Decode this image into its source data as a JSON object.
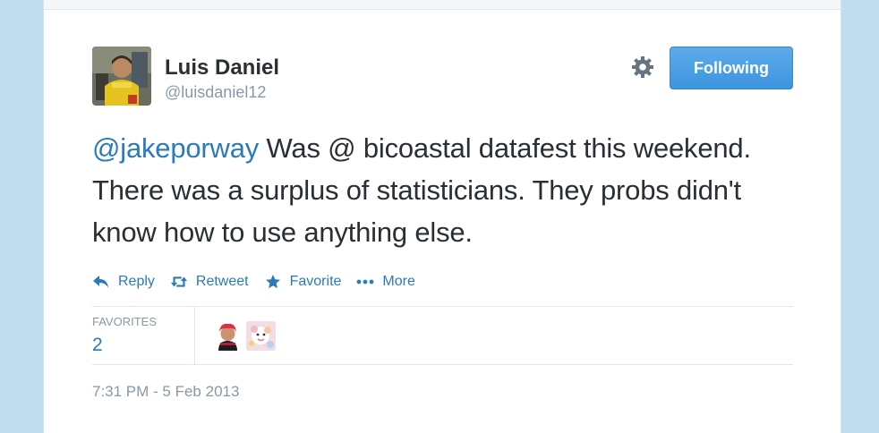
{
  "tweet": {
    "author_name": "Luis Daniel",
    "author_handle": "@luisdaniel12",
    "follow_label": "Following",
    "mention": "@jakeporway",
    "text": " Was @ bicoastal datafest this weekend. There was a surplus of statisticians. They probs didn't know how to use anything else.",
    "timestamp": "7:31 PM - 5 Feb 2013"
  },
  "actions": {
    "reply": "Reply",
    "retweet": "Retweet",
    "favorite": "Favorite",
    "more": "More"
  },
  "stats": {
    "favorites_label": "FAVORITES",
    "favorites_count": "2"
  },
  "colors": {
    "link": "#2b7bb9",
    "muted": "#8899a6",
    "text": "#292f33",
    "follow_button": "#4a9fe4",
    "background": "#c0deed"
  },
  "icons": {
    "settings": "gear-icon",
    "reply": "reply-icon",
    "retweet": "retweet-icon",
    "favorite": "star-icon",
    "more": "more-dots-icon"
  }
}
